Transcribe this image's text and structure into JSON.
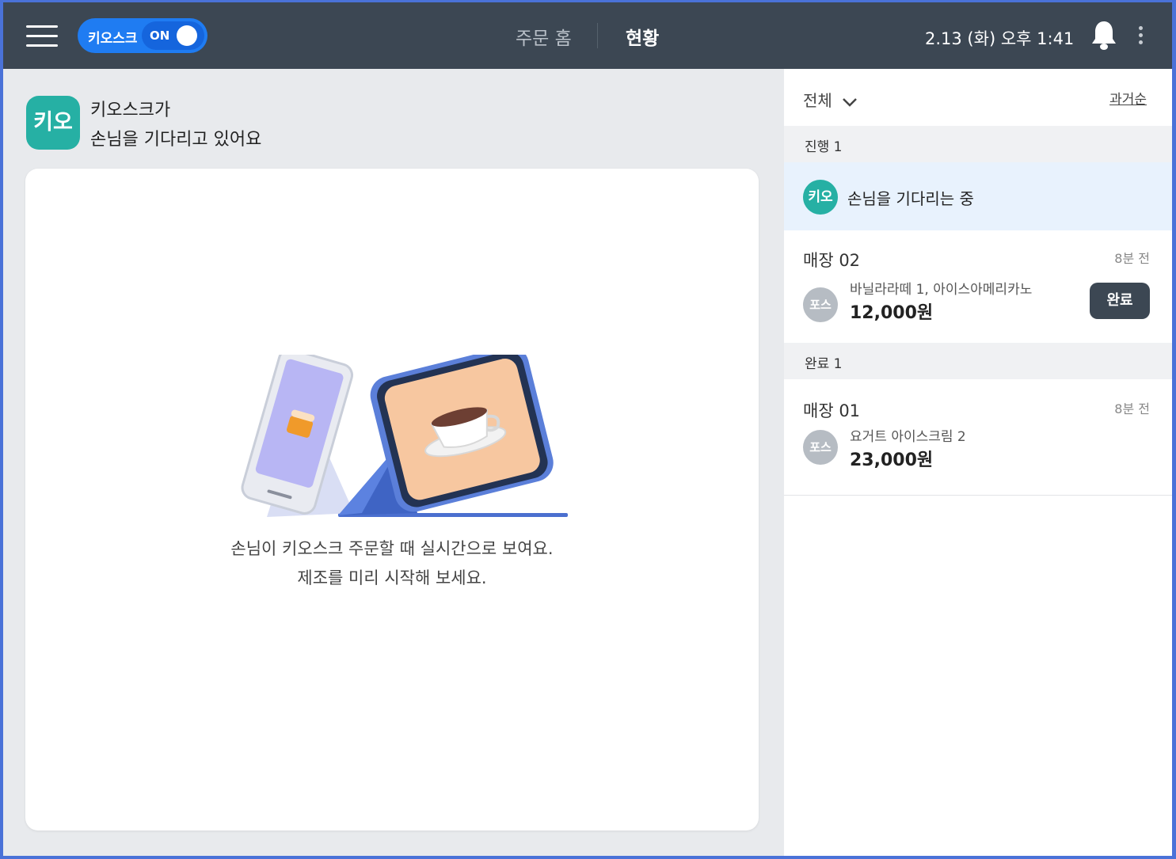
{
  "topbar": {
    "kiosk_label": "키오스크",
    "kiosk_state": "ON",
    "nav_home": "주문 홈",
    "nav_status": "현황",
    "datetime": "2.13 (화) 오후 1:41",
    "icons": [
      "menu-icon",
      "bell-icon",
      "more-vertical-icon"
    ]
  },
  "main": {
    "badge": "키오",
    "title_line1": "키오스크가",
    "title_line2": "손님을 기다리고 있어요",
    "hint_line1": "손님이 키오스크 주문할 때 실시간으로 보여요.",
    "hint_line2": "제조를 미리 시작해 보세요."
  },
  "panel": {
    "filter_label": "전체",
    "sort_label": "과거순",
    "in_progress_section": "진행 1",
    "waiting_badge": "키오",
    "waiting_text": "손님을 기다리는 중",
    "orders_in_progress": [
      {
        "table": "매장 02",
        "ago": "8분 전",
        "source": "포스",
        "items": "바닐라라떼 1, 아이스아메리카노",
        "price": "12,000원",
        "action": "완료"
      }
    ],
    "done_section": "완료 1",
    "orders_done": [
      {
        "table": "매장 01",
        "ago": "8분 전",
        "source": "포스",
        "items": "요거트 아이스크림 2",
        "price": "23,000원"
      }
    ]
  },
  "colors": {
    "topbar": "#3c4753",
    "kiosk_toggle": "#1f7cf2",
    "kiosk_badge": "#26b0a4",
    "waiting_row": "#e8f2fd",
    "done_button": "#3c4753"
  }
}
